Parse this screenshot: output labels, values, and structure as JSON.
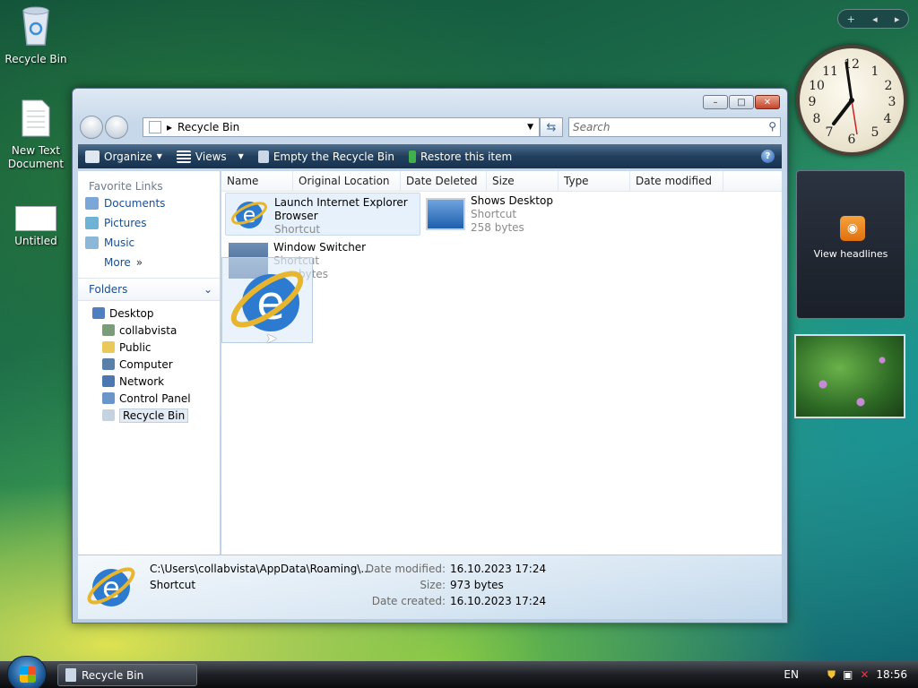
{
  "desktop": {
    "icons": [
      {
        "label": "Recycle Bin"
      },
      {
        "label": "New Text Document"
      },
      {
        "label": "Untitled"
      }
    ]
  },
  "window": {
    "address": "Recycle Bin",
    "search_placeholder": "Search",
    "buttons": {
      "minimize": "–",
      "maximize": "□",
      "close": "✕"
    }
  },
  "toolbar": {
    "organize": "Organize",
    "views": "Views",
    "empty": "Empty the Recycle Bin",
    "restore": "Restore this item",
    "help": "?"
  },
  "navpane": {
    "favorites_heading": "Favorite Links",
    "favorites": [
      "Documents",
      "Pictures",
      "Music",
      "More"
    ],
    "more_chevron": "»",
    "folders_heading": "Folders",
    "tree": [
      "Desktop",
      "collabvista",
      "Public",
      "Computer",
      "Network",
      "Control Panel",
      "Recycle Bin"
    ]
  },
  "columns": [
    "Name",
    "Original Location",
    "Date Deleted",
    "Size",
    "Type",
    "Date modified"
  ],
  "files": [
    {
      "name": "Launch Internet Explorer Browser",
      "type": "Shortcut",
      "size": ""
    },
    {
      "name": "Shows Desktop",
      "type": "Shortcut",
      "size": "258 bytes"
    },
    {
      "name": "Window Switcher",
      "type": "Shortcut",
      "size": "bytes"
    }
  ],
  "details": {
    "path": "C:\\Users\\collabvista\\AppData\\Roaming\\...",
    "kind": "Shortcut",
    "modified_label": "Date modified:",
    "modified": "16.10.2023 17:24",
    "size_label": "Size:",
    "size": "973 bytes",
    "created_label": "Date created:",
    "created": "16.10.2023 17:24"
  },
  "gadgets": {
    "headlines": "View headlines",
    "controls": [
      "+",
      "◂",
      "▸"
    ]
  },
  "taskbar": {
    "task": "Recycle Bin",
    "lang": "EN",
    "time": "18:56"
  },
  "colors": {
    "link": "#1c4d8f",
    "cmdbar": "#22405e"
  }
}
